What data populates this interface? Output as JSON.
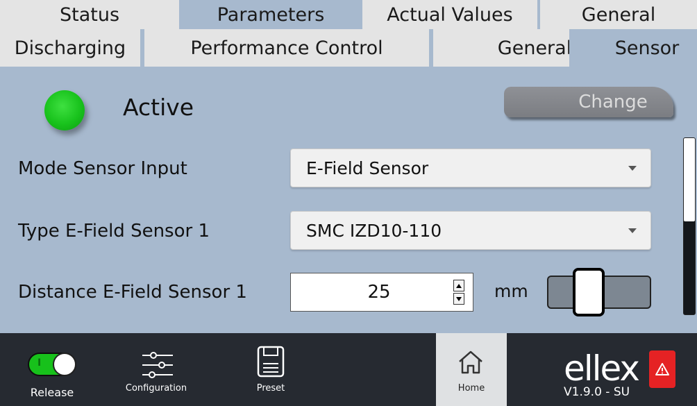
{
  "tabs_top": [
    "Status",
    "Parameters",
    "Actual Values",
    "General"
  ],
  "tabs_second": [
    "Discharging",
    "Performance Control",
    "General",
    "Sensor"
  ],
  "status": {
    "label": "Active",
    "led_color": "#1ec220"
  },
  "change_button": "Change",
  "fields": {
    "mode_sensor_input": {
      "label": "Mode Sensor Input",
      "value": "E-Field Sensor"
    },
    "type_sensor": {
      "label": "Type E-Field Sensor 1",
      "value": "SMC IZD10-110"
    },
    "distance_sensor": {
      "label": "Distance E-Field Sensor 1",
      "value": "25",
      "unit": "mm"
    }
  },
  "bottom_nav": {
    "release": "Release",
    "configuration": "Configuration",
    "preset": "Preset",
    "home": "Home"
  },
  "brand": {
    "name": "ellex",
    "version": "V1.9.0 - SU"
  },
  "colors": {
    "background": "#a7b9ce",
    "tab": "#e4e4e4",
    "bottom_bar": "#262a31",
    "alert": "#e52224",
    "toggle_on": "#17c11b"
  }
}
